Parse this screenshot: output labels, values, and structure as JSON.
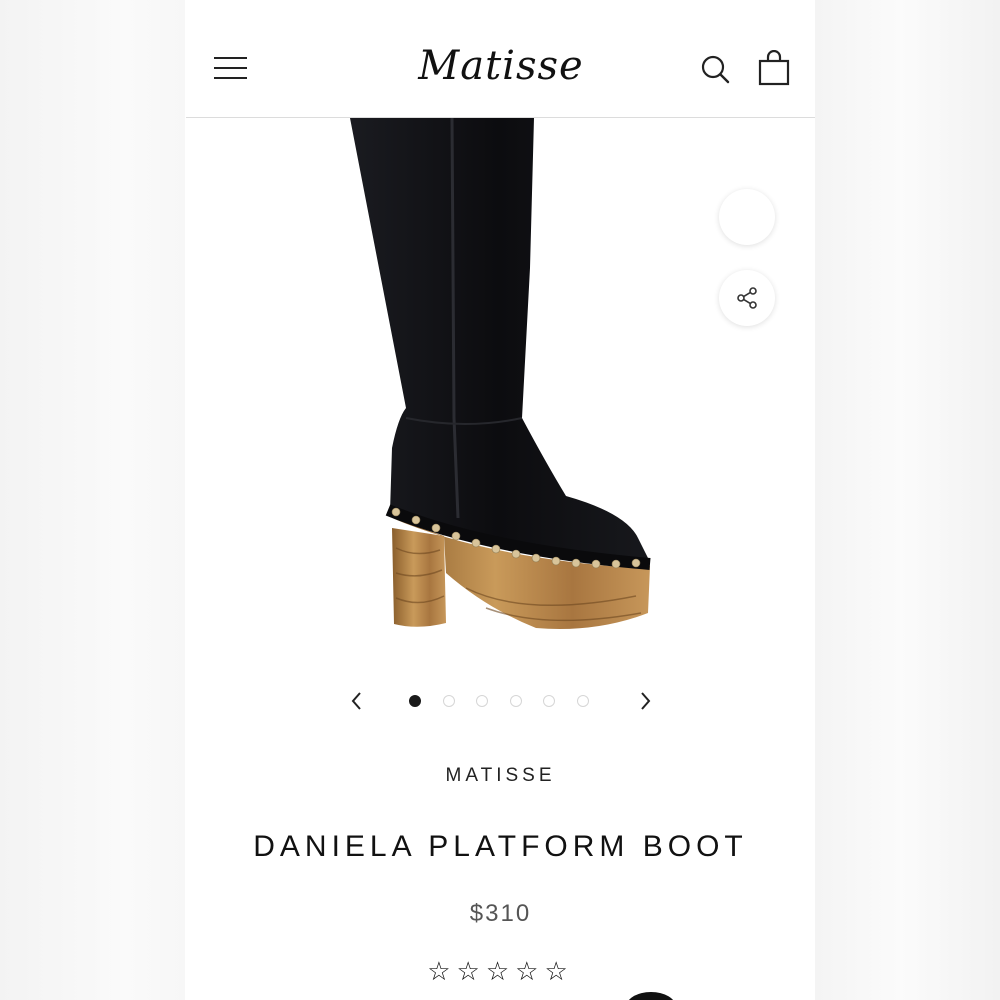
{
  "header": {
    "logo_text": "Matisse",
    "menu_icon": "hamburger-menu-icon",
    "search_icon": "search-icon",
    "cart_icon": "shopping-bag-icon"
  },
  "gallery": {
    "image_alt": "Black suede knee-high boot with wooden studded clog platform",
    "share_icon": "share-icon",
    "prev_icon": "chevron-left-icon",
    "next_icon": "chevron-right-icon",
    "slide_count": 6,
    "active_slide": 1
  },
  "product": {
    "brand": "MATISSE",
    "title": "DANIELA PLATFORM BOOT",
    "price": "$310",
    "rating_stars": "☆☆☆☆☆",
    "rating_value": 0,
    "rating_max": 5
  },
  "colors": {
    "text_primary": "#111111",
    "price": "#555555",
    "dot_active": "#1a1a1a",
    "dot_inactive": "#d6d6d6",
    "boot": "#0f0f12",
    "wood": "#b98a4e"
  }
}
